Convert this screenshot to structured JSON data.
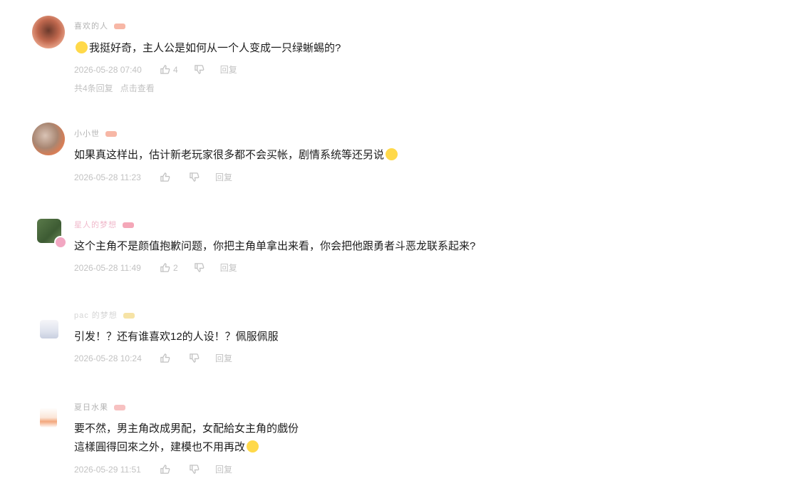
{
  "comments": [
    {
      "username": "喜欢的人",
      "text": "我挺好奇，主人公是如何从一个人变成一只绿蜥蜴的?",
      "time": "2026-05-28 07:40",
      "likes": "4",
      "reply_label": "回复",
      "replies_count": "共4条回复",
      "expand_label": "点击查看"
    },
    {
      "username": "小小世",
      "text": "如果真这样出，估计新老玩家很多都不会买帐，剧情系统等还另说",
      "time": "2026-05-28 11:23",
      "likes": "",
      "reply_label": "回复"
    },
    {
      "username": "星人的梦想",
      "text": "这个主角不是颜值抱歉问题，你把主角单拿出来看，你会把他跟勇者斗恶龙联系起来?",
      "time": "2026-05-28 11:49",
      "likes": "2",
      "reply_label": "回复"
    },
    {
      "username": "pac 的梦想",
      "text": "引发！？还有谁喜欢12的人设！？佩服佩服",
      "time": "2026-05-28 10:24",
      "likes": "",
      "reply_label": "回复"
    },
    {
      "username": "夏日水果",
      "text_line1": "要不然，男主角改成男配，女配給女主角的戲份",
      "text_line2": "這樣圓得回來之外，建模也不用再改",
      "time": "2026-05-29 11:51",
      "likes": "",
      "reply_label": "回复"
    }
  ],
  "colors": {
    "meta": "#c2c2c2",
    "text": "#1d1d1d",
    "badge": "#f7b7a6"
  }
}
